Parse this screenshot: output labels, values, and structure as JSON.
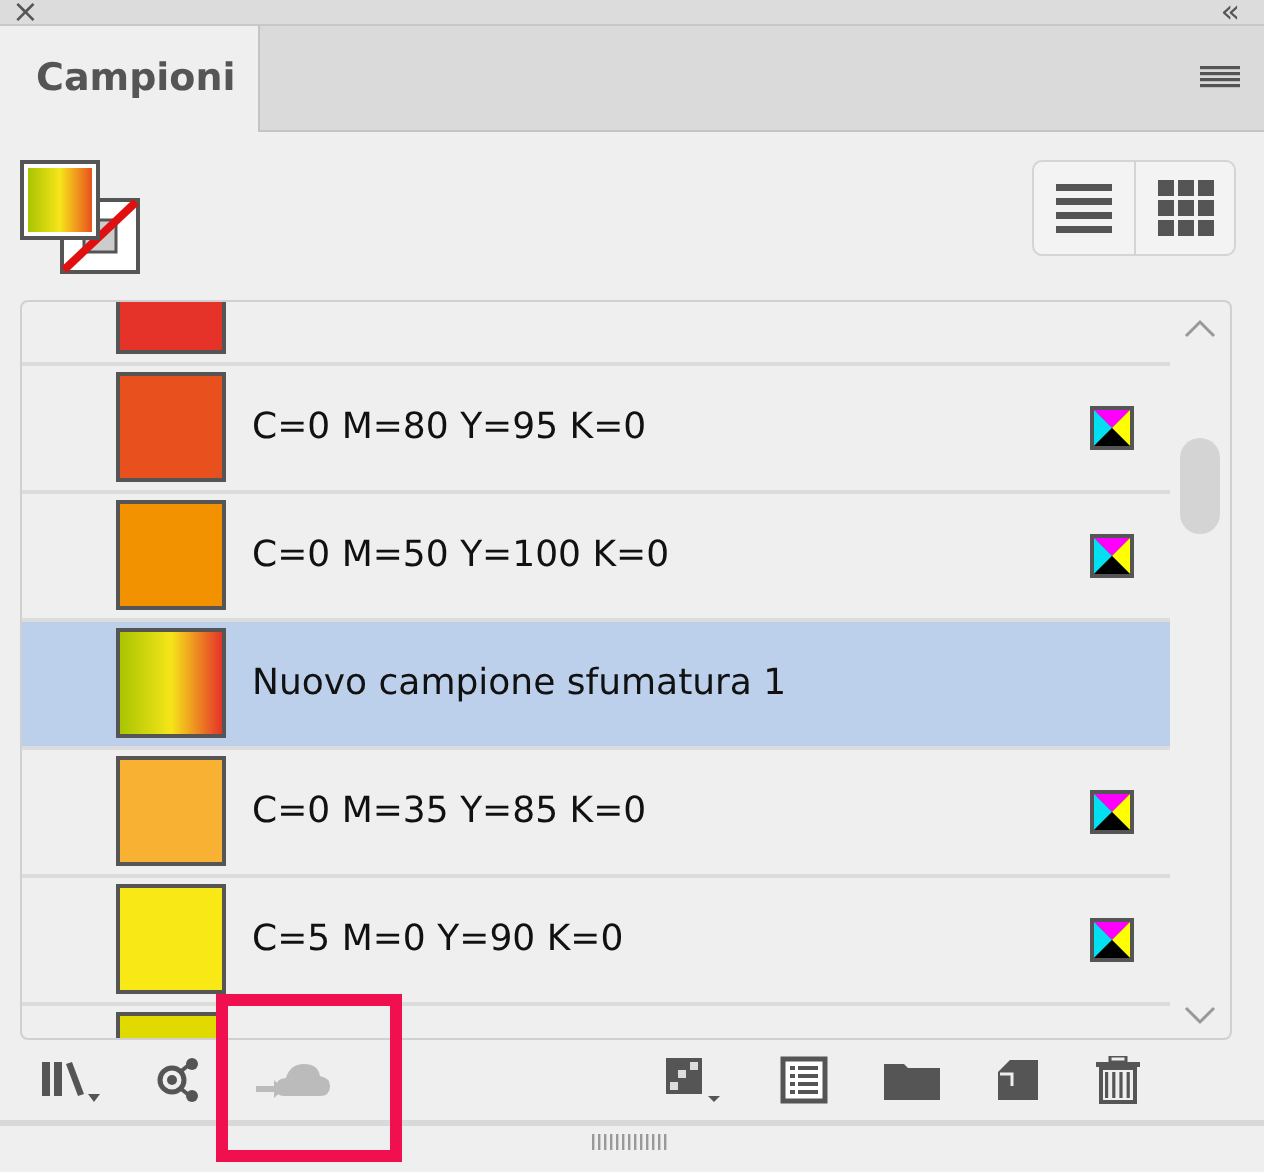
{
  "panel": {
    "close_glyph": "×",
    "collapse_glyph": "«"
  },
  "tabs": [
    {
      "label": "Campioni",
      "selected": true
    }
  ],
  "swatches": [
    {
      "kind": "process",
      "color": "#e6332a"
    },
    {
      "kind": "process",
      "name": "C=0 M=80 Y=95 K=0",
      "color": "#e8501e"
    },
    {
      "kind": "process",
      "name": "C=0 M=50 Y=100 K=0",
      "color": "#f39200"
    },
    {
      "kind": "gradient",
      "name": "Nuovo campione sfumatura 1",
      "selected": true
    },
    {
      "kind": "process",
      "name": "C=0 M=35 Y=85 K=0",
      "color": "#f8b133"
    },
    {
      "kind": "process",
      "name": "C=5 M=0 Y=90 K=0",
      "color": "#f8e816"
    },
    {
      "kind": "process",
      "color": "#e1da00"
    }
  ],
  "toolbar": {
    "cloud_highlighted": true
  }
}
